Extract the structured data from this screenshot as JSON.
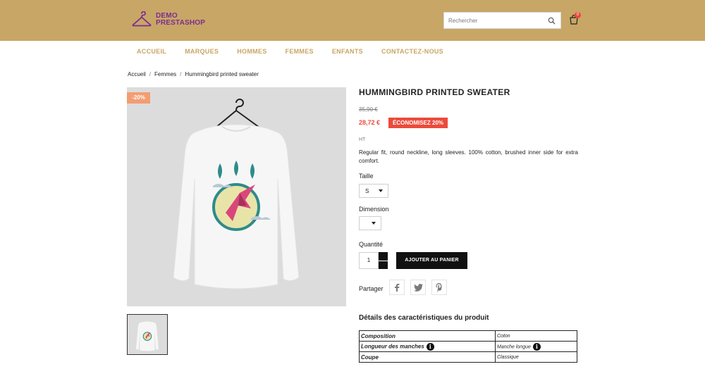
{
  "header": {
    "logo_line1": "DEMO",
    "logo_line2": "PRESTASHOP",
    "search_placeholder": "Rechercher",
    "cart_count": "0",
    "search_icon": "search-icon",
    "cart_icon": "shopping-cart-icon"
  },
  "nav": {
    "items": [
      "ACCUEIL",
      "MARQUES",
      "HOMMES",
      "FEMMES",
      "ENFANTS",
      "CONTACTEZ-NOUS"
    ]
  },
  "breadcrumb": [
    "Accueil",
    "Femmes",
    "Hummingbird printed sweater"
  ],
  "product": {
    "discount_flag": "-20%",
    "title": "HUMMINGBIRD PRINTED SWEATER",
    "old_price": "35,90 €",
    "price": "28,72 €",
    "save_badge": "ÉCONOMISEZ 20%",
    "tax_label": "HT",
    "description": "Regular fit, round neckline, long sleeves. 100% cotton, brushed inner side for extra comfort.",
    "size_label": "Taille",
    "size_value": "S",
    "dimension_label": "Dimension",
    "dimension_value": "",
    "quantity_label": "Quantité",
    "quantity_value": "1",
    "add_to_cart": "AJOUTER AU PANIER",
    "share_label": "Partager"
  },
  "details": {
    "title": "Détails des caractéristiques du produit",
    "rows": [
      {
        "key": "Composition",
        "value": "Coton"
      },
      {
        "key": "Longueur des manches",
        "value": "Manche longue"
      },
      {
        "key": "Coupe",
        "value": "Classique"
      }
    ]
  },
  "colors": {
    "header_bg": "#c8a666",
    "logo": "#7b2d8e",
    "accent_red": "#ec4a3b",
    "discount_flag": "#f39d72"
  }
}
